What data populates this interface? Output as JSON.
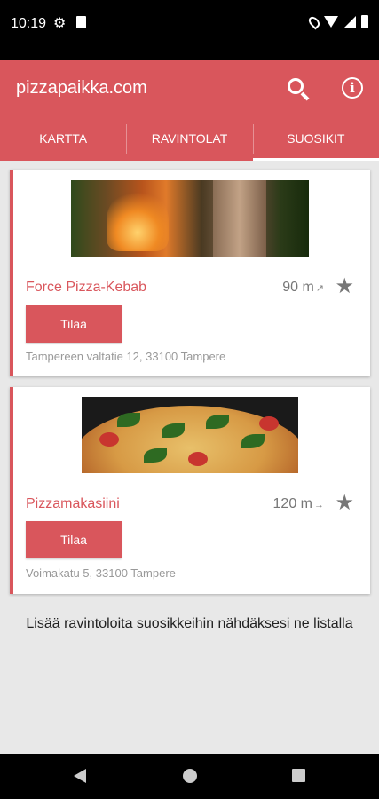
{
  "status": {
    "time": "10:19"
  },
  "app": {
    "title": "pizzapaikka.com"
  },
  "tabs": [
    {
      "label": "KARTTA"
    },
    {
      "label": "RAVINTOLAT"
    },
    {
      "label": "SUOSIKIT"
    }
  ],
  "restaurants": [
    {
      "name": "Force Pizza-Kebab",
      "distance": "90 m",
      "direction": "↗",
      "button": "Tilaa",
      "address": "Tampereen valtatie 12, 33100 Tampere"
    },
    {
      "name": "Pizzamakasiini",
      "distance": "120 m",
      "direction": "→",
      "button": "Tilaa",
      "address": "Voimakatu 5, 33100 Tampere"
    }
  ],
  "hint": "Lisää ravintoloita suosikkeihin nähdäksesi ne listalla",
  "colors": {
    "accent": "#d9565c"
  }
}
